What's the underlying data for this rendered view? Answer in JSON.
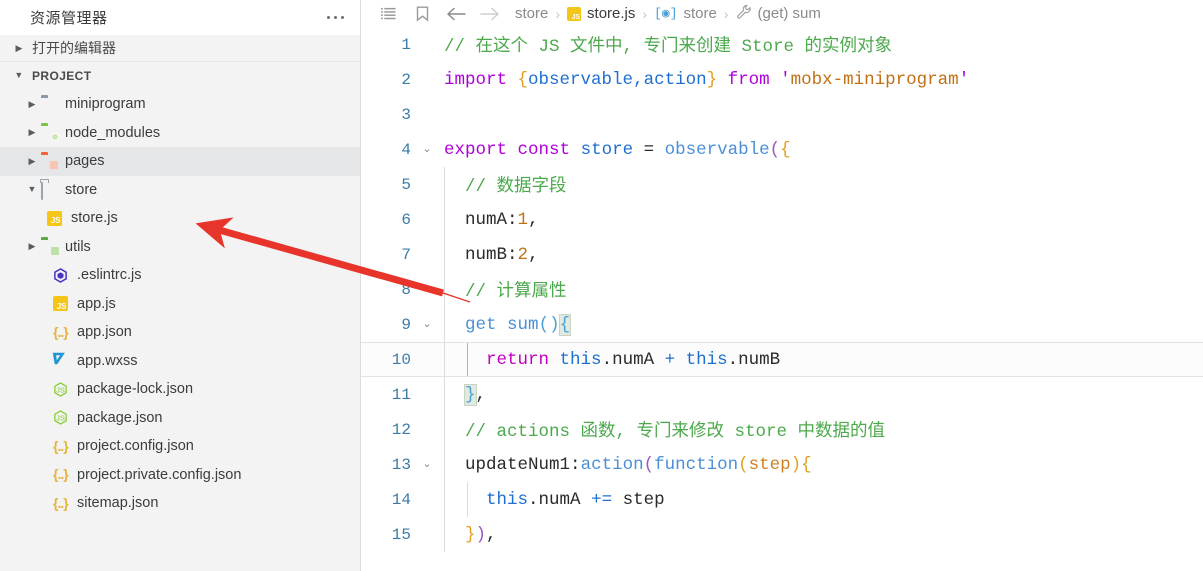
{
  "sidebar": {
    "title": "资源管理器",
    "more_icon": "more-horizontal-icon",
    "open_editors_label": "打开的编辑器",
    "project_label": "PROJECT",
    "tree": [
      {
        "label": "miniprogram",
        "type": "folder",
        "icon": "folder-gray-icon",
        "indent": 1,
        "expanded": false,
        "selected": false
      },
      {
        "label": "node_modules",
        "type": "folder",
        "icon": "folder-green-icon",
        "indent": 1,
        "expanded": false,
        "selected": false
      },
      {
        "label": "pages",
        "type": "folder",
        "icon": "folder-orange-icon",
        "indent": 1,
        "expanded": false,
        "selected": true
      },
      {
        "label": "store",
        "type": "folder",
        "icon": "folder-open-icon",
        "indent": 1,
        "expanded": true,
        "selected": false
      },
      {
        "label": "store.js",
        "type": "file",
        "icon": "js-file-icon",
        "indent": 2,
        "expanded": false,
        "selected": false
      },
      {
        "label": "utils",
        "type": "folder",
        "icon": "folder-green2-icon",
        "indent": 1,
        "expanded": false,
        "selected": false
      },
      {
        "label": ".eslintrc.js",
        "type": "file",
        "icon": "eslint-file-icon",
        "indent": 1,
        "expanded": false,
        "selected": false
      },
      {
        "label": "app.js",
        "type": "file",
        "icon": "js-file-icon",
        "indent": 1,
        "expanded": false,
        "selected": false
      },
      {
        "label": "app.json",
        "type": "file",
        "icon": "json-file-icon",
        "indent": 1,
        "expanded": false,
        "selected": false
      },
      {
        "label": "app.wxss",
        "type": "file",
        "icon": "css-file-icon",
        "indent": 1,
        "expanded": false,
        "selected": false
      },
      {
        "label": "package-lock.json",
        "type": "file",
        "icon": "node-file-icon",
        "indent": 1,
        "expanded": false,
        "selected": false
      },
      {
        "label": "package.json",
        "type": "file",
        "icon": "node-file-icon",
        "indent": 1,
        "expanded": false,
        "selected": false
      },
      {
        "label": "project.config.json",
        "type": "file",
        "icon": "json-file-icon",
        "indent": 1,
        "expanded": false,
        "selected": false
      },
      {
        "label": "project.private.config.json",
        "type": "file",
        "icon": "json-file-icon",
        "indent": 1,
        "expanded": false,
        "selected": false
      },
      {
        "label": "sitemap.json",
        "type": "file",
        "icon": "json-file-icon",
        "indent": 1,
        "expanded": false,
        "selected": false
      }
    ]
  },
  "breadcrumb": {
    "outline_icon": "outline-list-icon",
    "bookmark_icon": "bookmark-icon",
    "back_icon": "arrow-left-icon",
    "forward_icon": "arrow-right-icon",
    "items": [
      {
        "label": "store",
        "icon": null,
        "strong": false
      },
      {
        "label": "store.js",
        "icon": "js-file-icon",
        "strong": true
      },
      {
        "label": "store",
        "icon": "symbol-variable-icon",
        "strong": false
      },
      {
        "label": "(get) sum",
        "icon": "wrench-icon",
        "strong": false
      }
    ],
    "separator": "›"
  },
  "editor": {
    "active_line": 10,
    "lines": [
      {
        "num": 1,
        "fold": "",
        "indent_guides": 0
      },
      {
        "num": 2,
        "fold": "",
        "indent_guides": 0
      },
      {
        "num": 3,
        "fold": "",
        "indent_guides": 0
      },
      {
        "num": 4,
        "fold": "v",
        "indent_guides": 0
      },
      {
        "num": 5,
        "fold": "",
        "indent_guides": 1
      },
      {
        "num": 6,
        "fold": "",
        "indent_guides": 1
      },
      {
        "num": 7,
        "fold": "",
        "indent_guides": 1
      },
      {
        "num": 8,
        "fold": "",
        "indent_guides": 1
      },
      {
        "num": 9,
        "fold": "v",
        "indent_guides": 1
      },
      {
        "num": 10,
        "fold": "",
        "indent_guides": 2
      },
      {
        "num": 11,
        "fold": "",
        "indent_guides": 1
      },
      {
        "num": 12,
        "fold": "",
        "indent_guides": 1
      },
      {
        "num": 13,
        "fold": "v",
        "indent_guides": 1
      },
      {
        "num": 14,
        "fold": "",
        "indent_guides": 2
      },
      {
        "num": 15,
        "fold": "",
        "indent_guides": 1
      }
    ],
    "code": {
      "l1_comment": "// 在这个 JS 文件中, 专门来创建 Store 的实例对象",
      "l2_import": "import",
      "l2_brace_open": "{",
      "l2_names": "observable,action",
      "l2_brace_close": "}",
      "l2_from": "from",
      "l2_quote": "'",
      "l2_module": "mobx-miniprogram",
      "l4_export": "export",
      "l4_const": "const",
      "l4_store": "store",
      "l4_eq": "=",
      "l4_observable": "observable",
      "l4_paren": "(",
      "l4_brace": "{",
      "l5_comment": "// 数据字段",
      "l6_key": "numA",
      "l6_colon": ":",
      "l6_val": "1",
      "l6_comma": ",",
      "l7_key": "numB",
      "l7_colon": ":",
      "l7_val": "2",
      "l7_comma": ",",
      "l8_comment": "// 计算属性",
      "l9_get": "get",
      "l9_name": "sum",
      "l9_parens": "()",
      "l9_brace": "{",
      "l10_return": "return",
      "l10_this1": "this",
      "l10_dot1": ".",
      "l10_prop1": "numA",
      "l10_plus": "+",
      "l10_this2": "this",
      "l10_dot2": ".",
      "l10_prop2": "numB",
      "l11_brace": "}",
      "l11_comma": ",",
      "l12_comment": "// actions 函数, 专门来修改 store 中数据的值",
      "l13_key": "updateNum1",
      "l13_colon": ":",
      "l13_action": "action",
      "l13_paren1": "(",
      "l13_function": "function",
      "l13_paren2": "(",
      "l13_param": "step",
      "l13_paren3": ")",
      "l13_brace": "{",
      "l14_this": "this",
      "l14_dot": ".",
      "l14_prop": "numA",
      "l14_op": "+=",
      "l14_step": "step",
      "l15_brace": "}",
      "l15_paren": ")",
      "l15_comma": ","
    }
  },
  "annotation": {
    "arrow_color": "#e8352c",
    "arrow_name": "red-pointer-arrow"
  }
}
